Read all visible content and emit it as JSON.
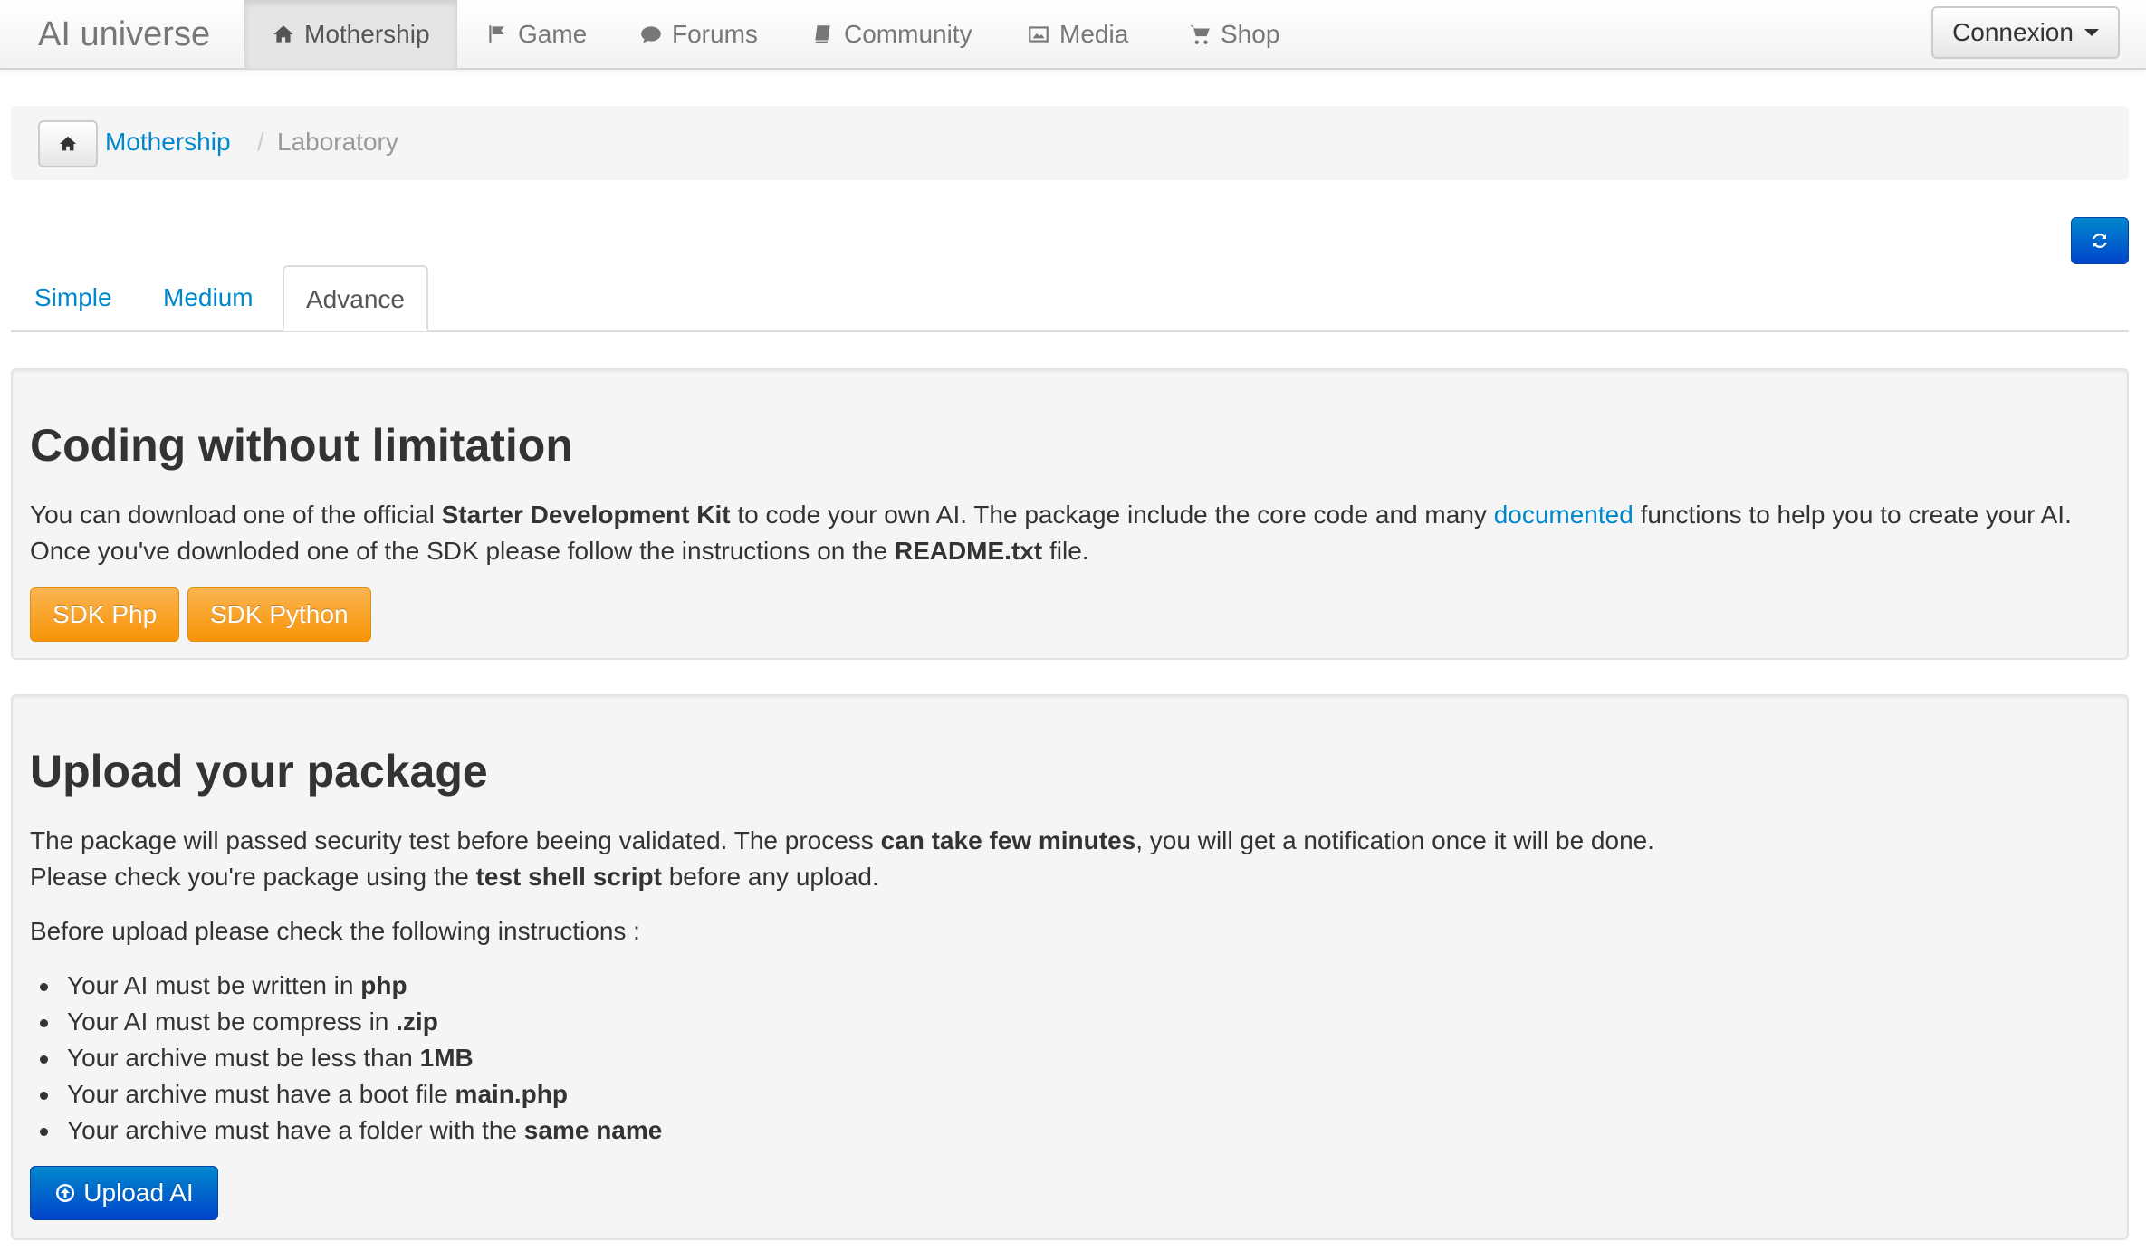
{
  "navbar": {
    "brand": "AI universe",
    "items": [
      {
        "label": "Mothership",
        "icon": "home-icon",
        "active": true
      },
      {
        "label": "Game",
        "icon": "flag-icon"
      },
      {
        "label": "Forums",
        "icon": "comments-icon"
      },
      {
        "label": "Community",
        "icon": "book-icon"
      },
      {
        "label": "Media",
        "icon": "picture-icon"
      },
      {
        "label": "Shop",
        "icon": "shopping-cart-icon"
      }
    ],
    "login_label": "Connexion"
  },
  "breadcrumb": {
    "home_icon": "home-icon",
    "link_label": "Mothership",
    "separator": "/",
    "current": "Laboratory"
  },
  "refresh_icon": "refresh-icon",
  "tabs": [
    {
      "label": "Simple"
    },
    {
      "label": "Medium"
    },
    {
      "label": "Advance",
      "active": true
    }
  ],
  "coding_section": {
    "title": "Coding without limitation",
    "line1": {
      "t1": "You can download one of the official ",
      "b1": "Starter Development Kit",
      "t2": " to code your own AI. The package include the core code and many ",
      "link": "documented",
      "t3": " functions to help you to create your AI."
    },
    "line2": {
      "t1": "Once you've downloded one of the SDK please follow the instructions on the ",
      "b1": "README.txt",
      "t2": " file."
    },
    "buttons": [
      "SDK Php",
      "SDK Python"
    ]
  },
  "upload_section": {
    "title": "Upload your package",
    "line1": {
      "t1": "The package will passed security test before beeing validated. The process ",
      "b1": "can take few minutes",
      "t2": ", you will get a notification once it will be done."
    },
    "line2": {
      "t1": "Please check you're package using the ",
      "b1": "test shell script",
      "t2": " before any upload."
    },
    "instructions_intro": "Before upload please check the following instructions :",
    "instructions": [
      {
        "text": "Your AI must be written in ",
        "bold": "php"
      },
      {
        "text": "Your AI must be compress in ",
        "bold": ".zip"
      },
      {
        "text": "Your archive must be less than ",
        "bold": "1MB"
      },
      {
        "text": "Your archive must have a boot file ",
        "bold": "main.php"
      },
      {
        "text": "Your archive must have a folder with the ",
        "bold": "same name"
      }
    ],
    "upload_button": "Upload AI",
    "upload_icon": "arrow-circle-up-icon"
  },
  "colors": {
    "link": "#0088cc",
    "primary": "#0055cc",
    "warning": "#f89406",
    "well_bg": "#f5f5f5"
  }
}
